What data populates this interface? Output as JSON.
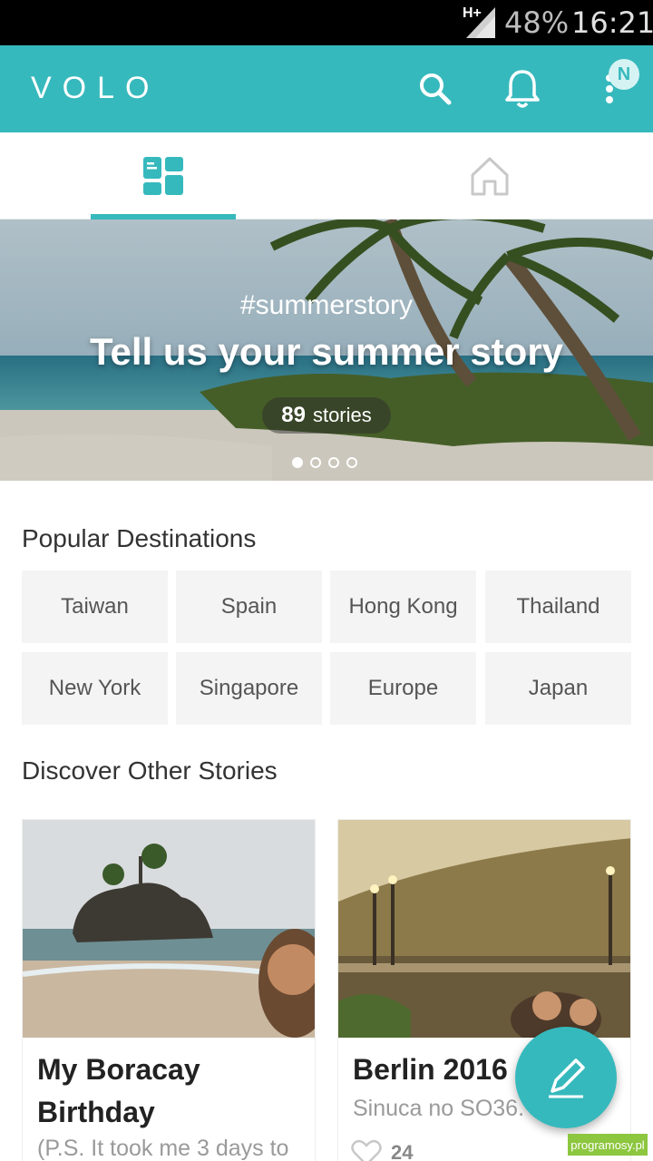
{
  "status_bar": {
    "network": "H+",
    "battery": "48%",
    "time": "16:21"
  },
  "app_bar": {
    "logo": "VOLO",
    "badge": "N"
  },
  "tabs": [
    {
      "icon": "dashboard-icon",
      "active": true
    },
    {
      "icon": "home-icon",
      "active": false
    }
  ],
  "banner": {
    "hashtag": "#summerstory",
    "title": "Tell us your summer story",
    "stories_count": "89",
    "stories_label": "stories",
    "carousel_pages": 4,
    "active_page": 1
  },
  "popular_destinations": {
    "title": "Popular Destinations",
    "items": [
      "Taiwan",
      "Spain",
      "Hong Kong",
      "Thailand",
      "New York",
      "Singapore",
      "Europe",
      "Japan"
    ]
  },
  "discover": {
    "title": "Discover Other Stories",
    "stories": [
      {
        "title": "My Boracay Birthday",
        "description": "(P.S. It took me 3 days to"
      },
      {
        "title": "Berlin 2016",
        "description": "Sinuca no SO36.",
        "likes": "24"
      }
    ]
  },
  "watermark": "programosy.pl",
  "colors": {
    "accent": "#36b9bd",
    "chip_bg": "#f4f4f4"
  }
}
